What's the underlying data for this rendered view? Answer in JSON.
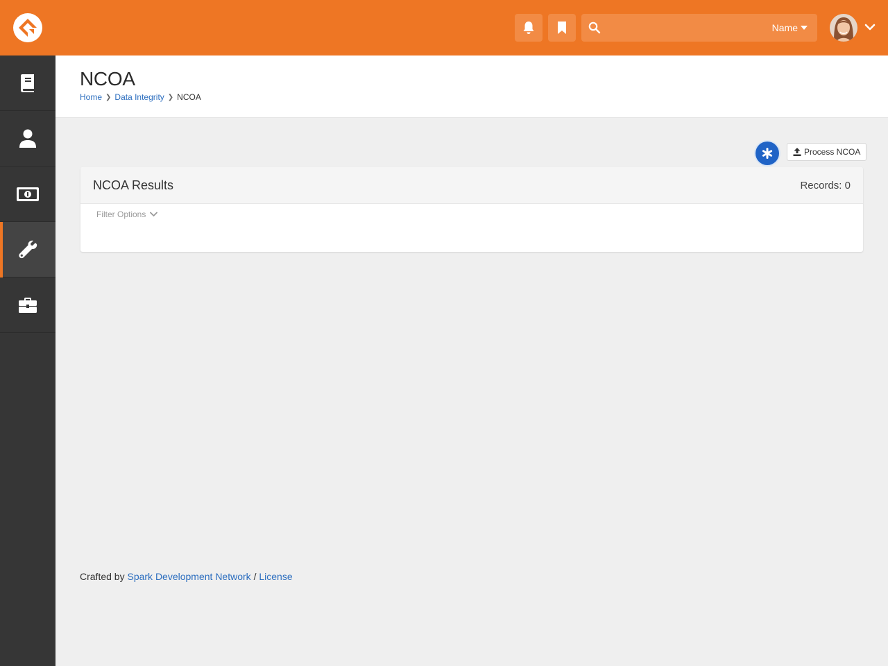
{
  "header": {
    "search_type_label": "Name",
    "search_placeholder": ""
  },
  "sidebar": {
    "items": [
      {
        "icon": "book-icon"
      },
      {
        "icon": "person-icon"
      },
      {
        "icon": "money-icon"
      },
      {
        "icon": "wrench-icon",
        "active": true
      },
      {
        "icon": "briefcase-icon"
      }
    ]
  },
  "page": {
    "title": "NCOA",
    "breadcrumb": [
      "Home",
      "Data Integrity",
      "NCOA"
    ]
  },
  "actions": {
    "process_label": "Process NCOA"
  },
  "panel": {
    "title": "NCOA Results",
    "records_label": "Records: 0",
    "filter_label": "Filter Options"
  },
  "footer": {
    "prefix": "Crafted by",
    "link1": "Spark Development Network",
    "separator": "/",
    "link2": "License"
  },
  "colors": {
    "brand": "#ee7624",
    "sidebar": "#363636",
    "link": "#2c6ebf",
    "badge": "#1f63c6"
  }
}
